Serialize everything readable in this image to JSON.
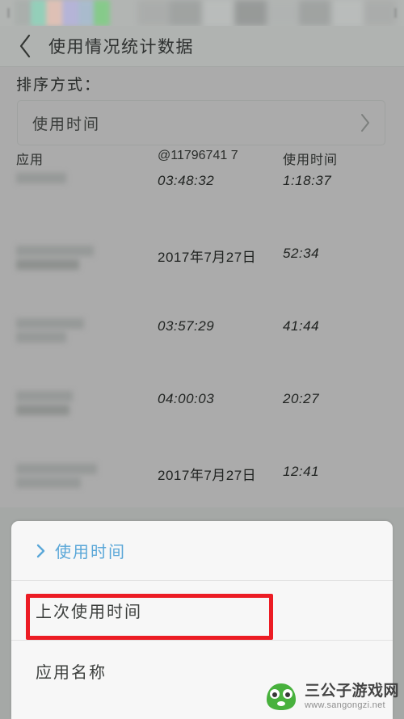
{
  "statusbar": {
    "icon_left": "signal-icon",
    "icon_right": "battery-icon"
  },
  "titlebar": {
    "back_icon": "chevron-left-icon",
    "title": "使用情况统计数据"
  },
  "sort": {
    "label": "排序方式：",
    "selected": "使用时间",
    "chevron_icon": "chevron-right-icon"
  },
  "table": {
    "headers": {
      "app": "应用",
      "last_used": "@11796741 7",
      "usage_time": "使用时间"
    },
    "rows": [
      {
        "app": "",
        "last_used": "03:48:32",
        "usage_time": "1:18:37"
      },
      {
        "app": "",
        "last_used": "2017年7月27日",
        "usage_time": "52:34"
      },
      {
        "app": "",
        "last_used": "03:57:29",
        "usage_time": "41:44"
      },
      {
        "app": "",
        "last_used": "04:00:03",
        "usage_time": "20:27"
      },
      {
        "app": "",
        "last_used": "2017年7月27日",
        "usage_time": "12:41"
      }
    ]
  },
  "sheet": {
    "items": [
      {
        "label": "使用时间",
        "icon": "chevron-right-icon",
        "selected": true
      },
      {
        "label": "上次使用时间",
        "icon": "",
        "selected": false
      },
      {
        "label": "应用名称",
        "icon": "",
        "selected": false
      }
    ],
    "highlight_color": "#ec1c24",
    "accent_color": "#5aa7d8"
  },
  "watermark": {
    "logo": "frog-logo-icon",
    "title": "三公子游戏网",
    "url": "www.sangongzi.net"
  }
}
